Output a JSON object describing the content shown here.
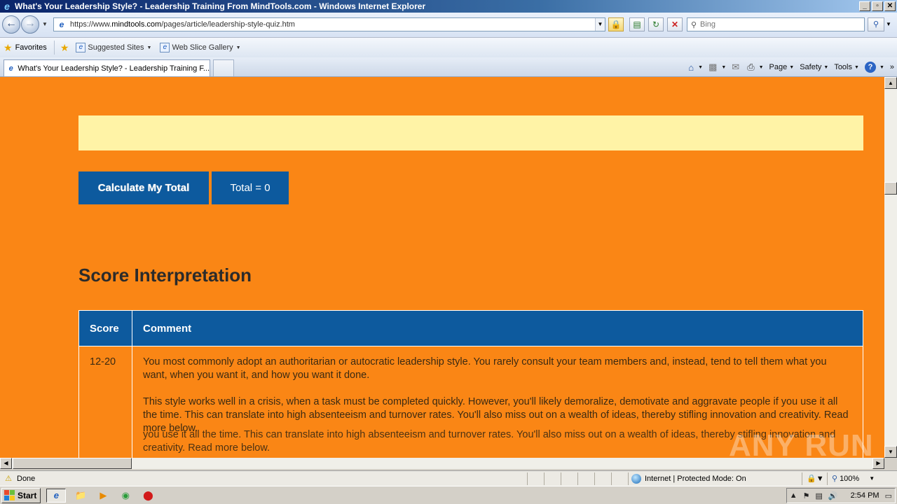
{
  "window": {
    "title": "What's Your Leadership Style? - Leadership Training From MindTools.com - Windows Internet Explorer",
    "buttons": {
      "minimize": "_",
      "restore": "▫",
      "close": "✕"
    }
  },
  "address_bar": {
    "url_prefix": "https://www.",
    "url_domain": "mindtools.com",
    "url_path": "/pages/article/leadership-style-quiz.htm",
    "search_placeholder": "Bing"
  },
  "favorites_bar": {
    "favorites_label": "Favorites",
    "links": [
      {
        "label": "Suggested Sites"
      },
      {
        "label": "Web Slice Gallery"
      }
    ]
  },
  "tabs": [
    {
      "label": "What's Your Leadership Style? - Leadership Training F..."
    }
  ],
  "command_bar": {
    "page": "Page",
    "safety": "Safety",
    "tools": "Tools"
  },
  "page": {
    "calculate_button": "Calculate My Total",
    "total_label": "Total = 0",
    "section_title": "Score Interpretation",
    "table": {
      "headers": [
        "Score",
        "Comment"
      ],
      "rows": [
        {
          "score": "12-20",
          "paragraph1": "You most commonly adopt an authoritarian or autocratic leadership style. You rarely consult your team members and, instead, tend to tell them what you want, when you want it, and how you want it done.",
          "paragraph2": "This style works well in a crisis, when a task must be completed quickly. However, you'll likely demoralize, demotivate and aggravate people if you use it all the time. This can translate into high absenteeism and turnover rates. You'll also miss out on a wealth of ideas, thereby stifling innovation and creativity. Read more below."
        }
      ]
    },
    "ghost_text": "you use it all the time. This can translate into high absenteeism and turnover rates. You'll also miss out on a wealth of ideas, thereby stifling innovation and creativity. Read more below."
  },
  "status_bar": {
    "status": "Done",
    "zone": "Internet | Protected Mode: On",
    "zoom": "100%"
  },
  "taskbar": {
    "start": "Start",
    "clock": "2:54 PM"
  },
  "watermark": "ANY RUN",
  "colors": {
    "page_background": "#fa8615",
    "button_blue": "#0d5a9e",
    "yellow_bar": "#fff3a6"
  }
}
